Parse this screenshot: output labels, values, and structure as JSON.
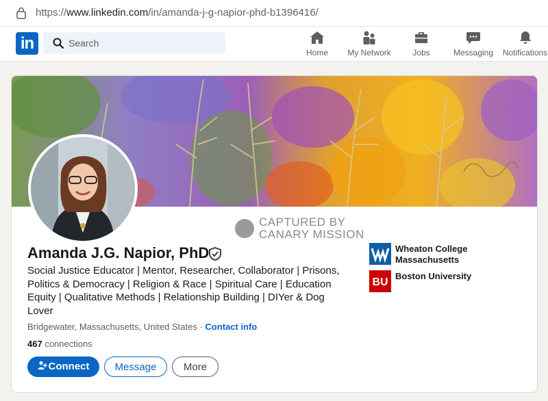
{
  "browser": {
    "url_prefix": "https://",
    "url_host": "www.linkedin.com",
    "url_path": "/in/amanda-j-g-napior-phd-b1396416/"
  },
  "nav": {
    "logo_text": "in",
    "search_placeholder": "Search",
    "items": [
      {
        "label": "Home",
        "icon": "home-icon"
      },
      {
        "label": "My Network",
        "icon": "network-icon"
      },
      {
        "label": "Jobs",
        "icon": "briefcase-icon"
      },
      {
        "label": "Messaging",
        "icon": "chat-icon"
      },
      {
        "label": "Notifications",
        "icon": "bell-icon"
      }
    ]
  },
  "watermark": {
    "line1": "CAPTURED BY",
    "line2": "CANARY MISSION"
  },
  "profile": {
    "name": "Amanda J.G. Napior, PhD",
    "headline": "Social Justice Educator | Mentor, Researcher, Collaborator | Prisons, Politics & Democracy | Religion & Race | Spiritual Care | Education Equity | Qualitative Methods | Relationship Building | DIYer & Dog Lover",
    "location": "Bridgewater, Massachusetts, United States",
    "separator": " · ",
    "contact_info": "Contact info",
    "connections_count": "467",
    "connections_label": " connections",
    "actions": {
      "connect": "Connect",
      "message": "Message",
      "more": "More"
    },
    "education": [
      {
        "name": "Wheaton College Massachusetts",
        "logo_text": "W",
        "color": "#0f5fa8"
      },
      {
        "name": "Boston University",
        "logo_text": "BU",
        "color": "#cc0000"
      }
    ]
  },
  "colors": {
    "accent": "#0a66c2",
    "background": "#f4f2ee"
  }
}
